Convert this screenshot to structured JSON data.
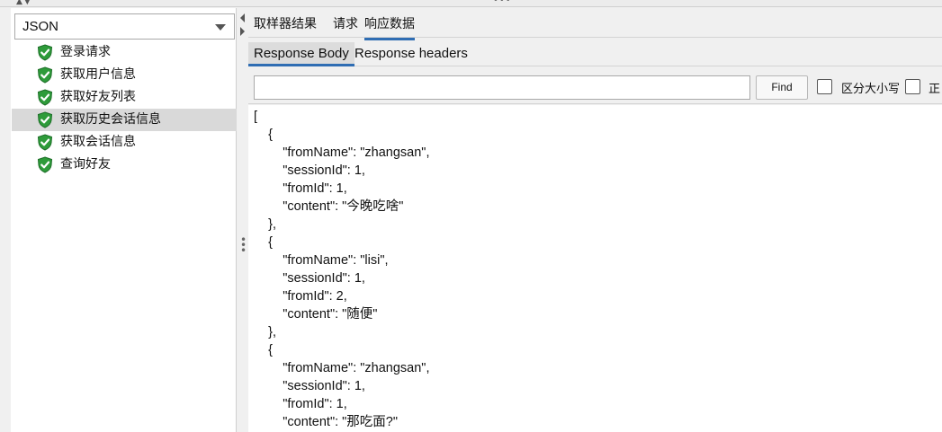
{
  "left_panel": {
    "format_select": "JSON",
    "tree_items": [
      {
        "label": "登录请求",
        "selected": false
      },
      {
        "label": "获取用户信息",
        "selected": false
      },
      {
        "label": "获取好友列表",
        "selected": false
      },
      {
        "label": "获取历史会话信息",
        "selected": true
      },
      {
        "label": "获取会话信息",
        "selected": false
      },
      {
        "label": "查询好友",
        "selected": false
      }
    ],
    "status_icon": "green-shield-check-icon"
  },
  "top_tabs": [
    "取样器结果",
    "请求",
    "响应数据"
  ],
  "active_top_tab": "响应数据",
  "sub_tabs": [
    "Response Body",
    "Response headers"
  ],
  "active_sub_tab": "Response Body",
  "find_bar": {
    "search_value": "",
    "find_button": "Find",
    "case_sensitive_label": "区分大小写",
    "case_sensitive_checked": false,
    "regex_label": "正",
    "regex_checked": false
  },
  "response_body_lines": [
    "[",
    "    {",
    "        \"fromName\": \"zhangsan\",",
    "        \"sessionId\": 1,",
    "        \"fromId\": 1,",
    "        \"content\": \"今晚吃啥\"",
    "    },",
    "    {",
    "        \"fromName\": \"lisi\",",
    "        \"sessionId\": 1,",
    "        \"fromId\": 2,",
    "        \"content\": \"随便\"",
    "    },",
    "    {",
    "        \"fromName\": \"zhangsan\",",
    "        \"sessionId\": 1,",
    "        \"fromId\": 1,",
    "        \"content\": \"那吃面?\""
  ],
  "colors": {
    "accent": "#2f6db3",
    "selected_row": "#d9d9d9",
    "shield_green": "#2e9b3a"
  }
}
